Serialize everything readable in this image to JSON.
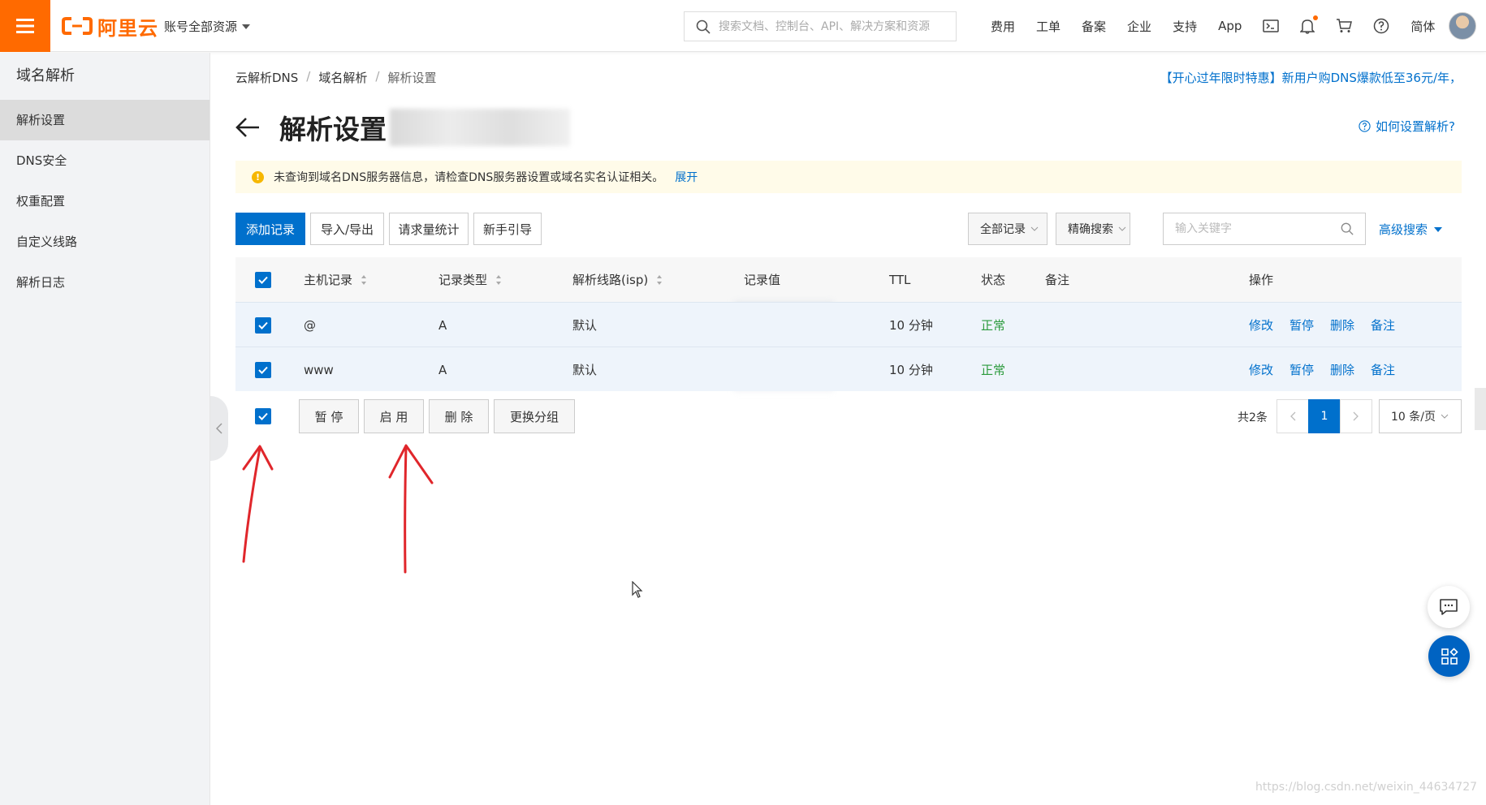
{
  "topbar": {
    "logo_text": "阿里云",
    "account_label": "账号全部资源",
    "search_placeholder": "搜索文档、控制台、API、解决方案和资源",
    "nav": [
      "费用",
      "工单",
      "备案",
      "企业",
      "支持",
      "App"
    ],
    "lang": "简体",
    "brand_color": "#ff6a00"
  },
  "sidebar": {
    "title": "域名解析",
    "items": [
      {
        "label": "解析设置",
        "active": true
      },
      {
        "label": "DNS安全",
        "active": false
      },
      {
        "label": "权重配置",
        "active": false
      },
      {
        "label": "自定义线路",
        "active": false
      },
      {
        "label": "解析日志",
        "active": false
      }
    ]
  },
  "breadcrumb": [
    "云解析DNS",
    "域名解析",
    "解析设置"
  ],
  "promo": "【开心过年限时特惠】新用户购DNS爆款低至36元/年，",
  "page_title": "解析设置",
  "help_link": "如何设置解析?",
  "notice": {
    "text": "未查询到域名DNS服务器信息，请检查DNS服务器设置或域名实名认证相关。",
    "expand": "展开"
  },
  "toolbar": {
    "add": "添加记录",
    "import_export": "导入/导出",
    "stats": "请求量统计",
    "guide": "新手引导",
    "filter_all": "全部记录",
    "search_mode": "精确搜索",
    "keyword_placeholder": "输入关键字",
    "advanced": "高级搜索"
  },
  "table": {
    "headers": {
      "host": "主机记录",
      "type": "记录类型",
      "line": "解析线路(isp)",
      "value": "记录值",
      "ttl": "TTL",
      "status": "状态",
      "remark": "备注",
      "ops": "操作"
    },
    "rows": [
      {
        "host": "@",
        "type": "A",
        "line": "默认",
        "ttl": "10 分钟",
        "status": "正常"
      },
      {
        "host": "www",
        "type": "A",
        "line": "默认",
        "ttl": "10 分钟",
        "status": "正常"
      }
    ],
    "row_ops": [
      "修改",
      "暂停",
      "删除",
      "备注"
    ]
  },
  "batch": {
    "pause": "暂 停",
    "enable": "启 用",
    "delete": "删 除",
    "regroup": "更换分组"
  },
  "pagination": {
    "total": "共2条",
    "current": "1",
    "page_size": "10 条/页"
  },
  "watermark": "https://blog.csdn.net/weixin_44634727",
  "accent_color": "#0070cc",
  "status_color": "#2b9a3c"
}
